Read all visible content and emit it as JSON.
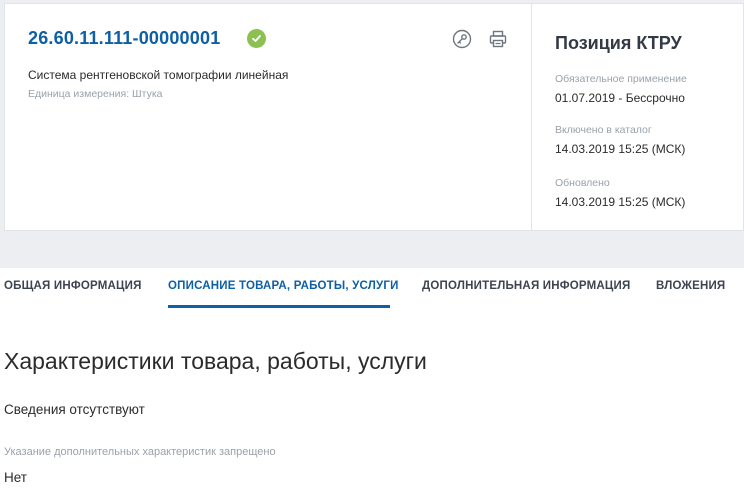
{
  "card": {
    "code": "26.60.11.111-00000001",
    "status_icon": "check-circle-icon",
    "status_color": "#8cc152",
    "item_name": "Система рентгеновской томографии линейная",
    "unit": "Единица измерения: Штука",
    "actions": [
      "key-icon",
      "printer-icon"
    ]
  },
  "position": {
    "title": "Позиция КТРУ",
    "mandatory_label": "Обязательное применение",
    "mandatory_value": "01.07.2019  - Бессрочно",
    "included_label": "Включено в каталог",
    "included_value": "14.03.2019 15:25 (МСК)",
    "updated_label": "Обновлено",
    "updated_value": "14.03.2019 15:25 (МСК)"
  },
  "tabs": [
    {
      "label": "ОБЩАЯ ИНФОРМАЦИЯ",
      "active": false
    },
    {
      "label": "ОПИСАНИЕ ТОВАРА, РАБОТЫ, УСЛУГИ",
      "active": true
    },
    {
      "label": "ДОПОЛНИТЕЛЬНАЯ ИНФОРМАЦИЯ",
      "active": false
    },
    {
      "label": "ВЛОЖЕНИЯ",
      "active": false
    }
  ],
  "content": {
    "section_title": "Характеристики товара, работы, услуги",
    "no_data": "Сведения отсутствуют",
    "restriction_label": "Указание дополнительных характеристик запрещено",
    "restriction_value": "Нет"
  },
  "colors": {
    "accent": "#0d5fa6",
    "band_background": "#eceef2"
  }
}
